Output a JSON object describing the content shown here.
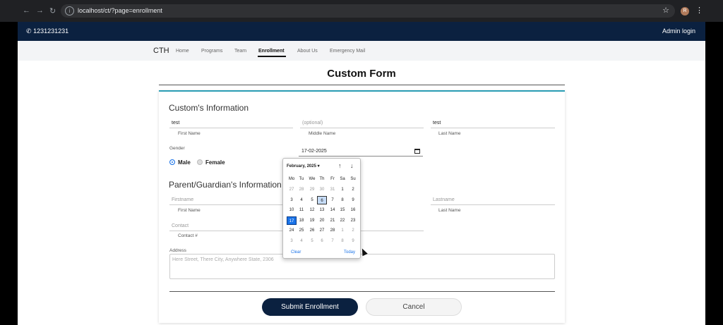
{
  "browser": {
    "url": "localhost/ct/?page=enrollment",
    "avatar_initial": "R",
    "back": "←",
    "forward": "→",
    "reload": "↻",
    "info": "i",
    "star": "☆",
    "menu": "⋮"
  },
  "topbar": {
    "phone": "1231231231",
    "admin": "Admin login",
    "phone_icon": "✆"
  },
  "nav": {
    "brand": "CTH",
    "links": [
      "Home",
      "Programs",
      "Team",
      "Enrollment",
      "About Us",
      "Emergency Mail"
    ],
    "active": "Enrollment"
  },
  "form": {
    "title": "Custom Form",
    "section1": "Custom's Information",
    "first_name_value": "test",
    "first_name_label": "First Name",
    "middle_name_placeholder": "(optional)",
    "middle_name_label": "Middle Name",
    "last_name_value": "test",
    "last_name_label": "Last Name",
    "gender_label": "Gender",
    "gender_male": "Male",
    "gender_female": "Female",
    "date_value": "17-02-2025",
    "section2": "Parent/Guardian's Information",
    "guardian_first_placeholder": "Firstname",
    "guardian_first_label": "First Name",
    "guardian_last_placeholder": "Lastname",
    "guardian_last_label": "Last Name",
    "contact_placeholder": "Contact",
    "contact_label": "Contact #",
    "address_label": "Address",
    "address_placeholder": "Here Street, There City, Anywhere State, 2306",
    "submit": "Submit Enrollment",
    "cancel": "Cancel"
  },
  "picker": {
    "month": "February, 2025 ▾",
    "up": "↑",
    "down": "↓",
    "days_of_week": [
      "Mo",
      "Tu",
      "We",
      "Th",
      "Fr",
      "Sa",
      "Su"
    ],
    "weeks": [
      [
        "27",
        "28",
        "29",
        "30",
        "31",
        "1",
        "2"
      ],
      [
        "3",
        "4",
        "5",
        "6",
        "7",
        "8",
        "9"
      ],
      [
        "10",
        "11",
        "12",
        "13",
        "14",
        "15",
        "16"
      ],
      [
        "17",
        "18",
        "19",
        "20",
        "21",
        "22",
        "23"
      ],
      [
        "24",
        "25",
        "26",
        "27",
        "28",
        "1",
        "2"
      ],
      [
        "3",
        "4",
        "5",
        "6",
        "7",
        "8",
        "9"
      ]
    ],
    "clear": "Clear",
    "today": "Today",
    "today_date": "6",
    "selected_date": "17"
  }
}
